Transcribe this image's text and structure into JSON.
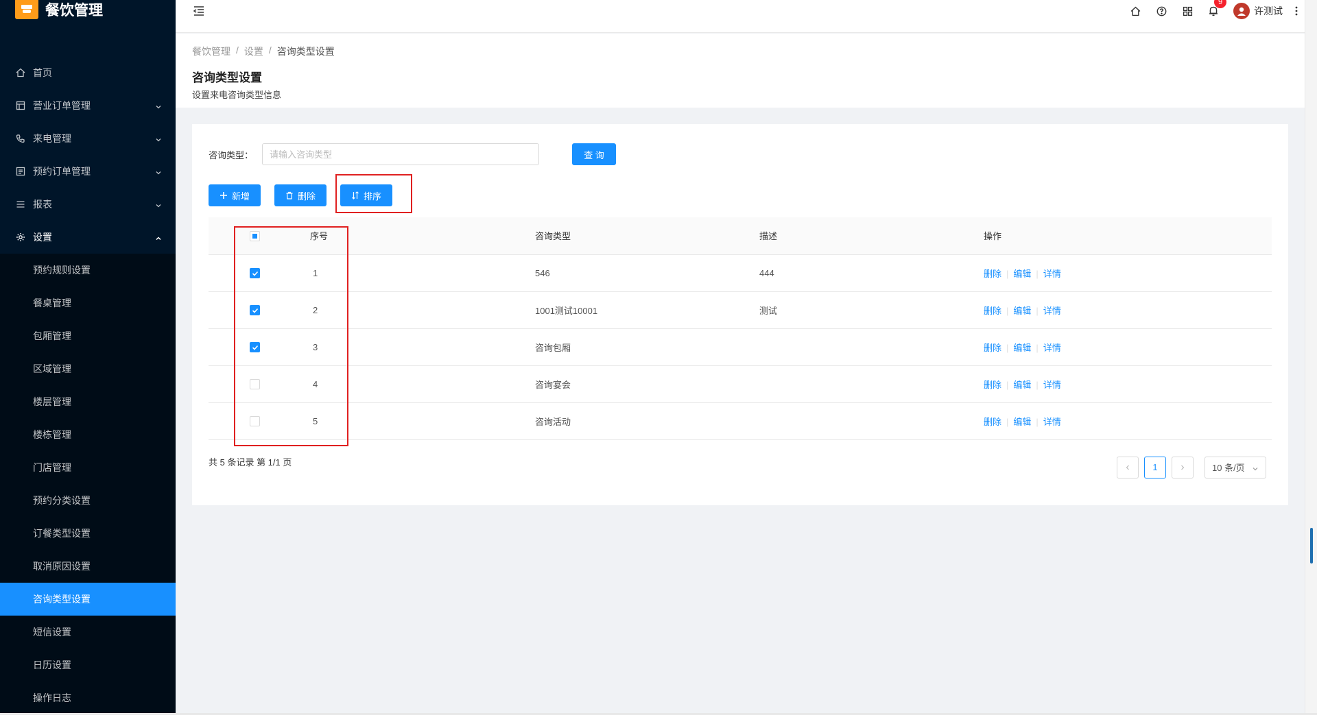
{
  "app": {
    "title": "餐饮管理"
  },
  "sidebar": {
    "items": [
      {
        "label": "首页",
        "icon": "home-icon"
      },
      {
        "label": "营业订单管理",
        "icon": "table-icon"
      },
      {
        "label": "来电管理",
        "icon": "phone-icon"
      },
      {
        "label": "预约订单管理",
        "icon": "list-icon"
      },
      {
        "label": "报表",
        "icon": "menu-icon"
      },
      {
        "label": "设置",
        "icon": "gear-icon"
      }
    ],
    "settings_sub": [
      "预约规则设置",
      "餐桌管理",
      "包厢管理",
      "区域管理",
      "楼层管理",
      "楼栋管理",
      "门店管理",
      "预约分类设置",
      "订餐类型设置",
      "取消原因设置",
      "咨询类型设置",
      "短信设置",
      "日历设置",
      "操作日志"
    ]
  },
  "header": {
    "notification_count": "9",
    "username": "许测试"
  },
  "breadcrumb": {
    "items": [
      "餐饮管理",
      "设置",
      "咨询类型设置"
    ],
    "sep": "/"
  },
  "page": {
    "title": "咨询类型设置",
    "desc": "设置来电咨询类型信息"
  },
  "search": {
    "label": "咨询类型：",
    "placeholder": "请输入咨询类型",
    "query_label": "查 询"
  },
  "toolbar": {
    "add_label": "新增",
    "delete_label": "删除",
    "sort_label": "排序"
  },
  "table": {
    "headers": {
      "seq": "序号",
      "type": "咨询类型",
      "desc": "描述",
      "ops": "操作"
    },
    "ops": {
      "delete": "删除",
      "edit": "编辑",
      "detail": "详情"
    },
    "rows": [
      {
        "seq": "1",
        "type": "546",
        "desc": "444",
        "checked": true
      },
      {
        "seq": "2",
        "type": "1001测试10001",
        "desc": "测试",
        "checked": true
      },
      {
        "seq": "3",
        "type": "咨询包厢",
        "desc": "",
        "checked": true
      },
      {
        "seq": "4",
        "type": "咨询宴会",
        "desc": "",
        "checked": false
      },
      {
        "seq": "5",
        "type": "咨询活动",
        "desc": "",
        "checked": false
      }
    ]
  },
  "pagination": {
    "total_text": "共 5 条记录 第 1/1 页",
    "current": "1",
    "page_size": "10 条/页"
  }
}
